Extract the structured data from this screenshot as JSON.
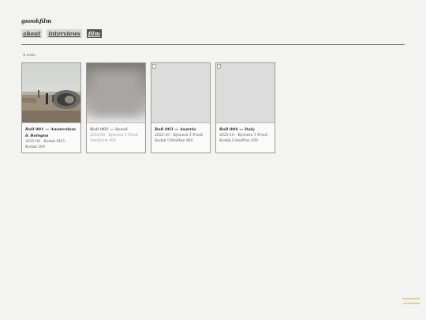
{
  "site": {
    "title": "gsookfilm"
  },
  "nav": [
    {
      "label": "about",
      "active": false
    },
    {
      "label": "interviews",
      "active": false
    },
    {
      "label": "film",
      "active": true
    }
  ],
  "gallery": {
    "count_text": "4 rolls",
    "cards": [
      {
        "title": "Roll 001 — Amsterdam & Bologna",
        "meta": "2025-06 · Kodak M35 · Kodak 200",
        "image": "photo"
      },
      {
        "title": "Roll 002 — Seoul",
        "meta": "2025-09 · Kyocera T Proof · Ventiform 400",
        "image": "blurred"
      },
      {
        "title": "Roll 003 — Austria",
        "meta": "2025-10 · Kyocera T Proof · Kodak UltraMax 400",
        "image": "broken"
      },
      {
        "title": "Roll 004 — Italy",
        "meta": "2025-10 · Kyocera T Proof · Kodak ColorPlus 200",
        "image": "broken"
      }
    ]
  },
  "corner": {
    "line1": "vimeo/seede",
    "line2": "socialmedia"
  }
}
